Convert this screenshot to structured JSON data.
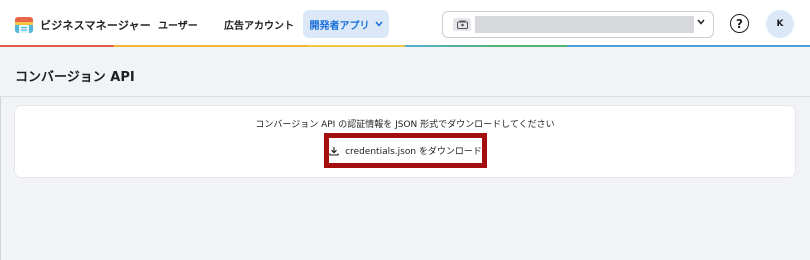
{
  "header": {
    "brand": "ビジネスマネージャー",
    "nav": [
      {
        "label": "ユーザー"
      },
      {
        "label": "広告アカウント"
      },
      {
        "label": "開発者アプリ"
      }
    ],
    "avatar_initial": "K",
    "help_label": "?"
  },
  "page": {
    "title": "コンバージョン API"
  },
  "card": {
    "description": "コンバージョン API の認証情報を JSON 形式でダウンロードしてください",
    "download_label": "credentials.json をダウンロード"
  },
  "icons": {
    "logo": "business-manager-logo",
    "account": "account-icon",
    "caret": "chevron-down-icon",
    "help": "help-icon",
    "download": "download-icon"
  },
  "colors": {
    "active_nav_bg": "#dbe8f8",
    "active_nav_text": "#1a6fd8",
    "highlight_border": "#a30f0f",
    "page_bg": "#f2f3f7"
  }
}
